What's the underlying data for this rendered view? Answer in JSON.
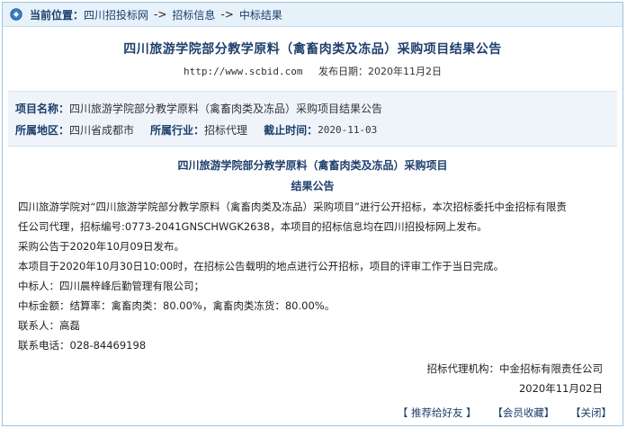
{
  "breadcrumb": {
    "label": "当前位置：",
    "home": "四川招投标网",
    "sep1": "->",
    "section": "招标信息",
    "sep2": "->",
    "current": "中标结果"
  },
  "article": {
    "title": "四川旅游学院部分教学原料（禽畜肉类及冻品）采购项目结果公告",
    "url": "http://www.scbid.com",
    "publish_label": "发布日期：",
    "publish_date": "2020年11月2日"
  },
  "info": {
    "project_name_label": "项目名称：",
    "project_name": "四川旅游学院部分教学原料（禽畜肉类及冻品）采购项目结果公告",
    "region_label": "所属地区：",
    "region": "四川省成都市",
    "industry_label": "所属行业：",
    "industry": "招标代理",
    "deadline_label": "截止时间：",
    "deadline": "2020-11-03"
  },
  "content": {
    "heading1": "四川旅游学院部分教学原料（禽畜肉类及冻品）采购项目",
    "heading2": "结果公告",
    "p1": "四川旅游学院对“四川旅游学院部分教学原料（禽畜肉类及冻品）采购项目”进行公开招标，本次招标委托中金招标有限责",
    "p1b": "任公司代理，招标编号:0773-2041GNSCHWGK2638，本项目的招标信息均在四川招投标网上发布。",
    "p2": "采购公告于2020年10月09日发布。",
    "p3": "本项目于2020年10月30日10:00时，在招标公告载明的地点进行公开招标，项目的评审工作于当日完成。",
    "p4": "中标人：四川晨梓峰后勤管理有限公司；",
    "p5": "中标金额：结算率：禽畜肉类：80.00%，禽畜肉类冻货：80.00%。",
    "p6": "联系人：高磊",
    "p7": "联系电话：028-84469198",
    "agency": "招标代理机构：中金招标有限责任公司",
    "sign_date": "2020年11月02日"
  },
  "footer": {
    "recommend": "【 推荐给好友 】",
    "favorite": "【会员收藏】",
    "close": "【关闭】"
  }
}
